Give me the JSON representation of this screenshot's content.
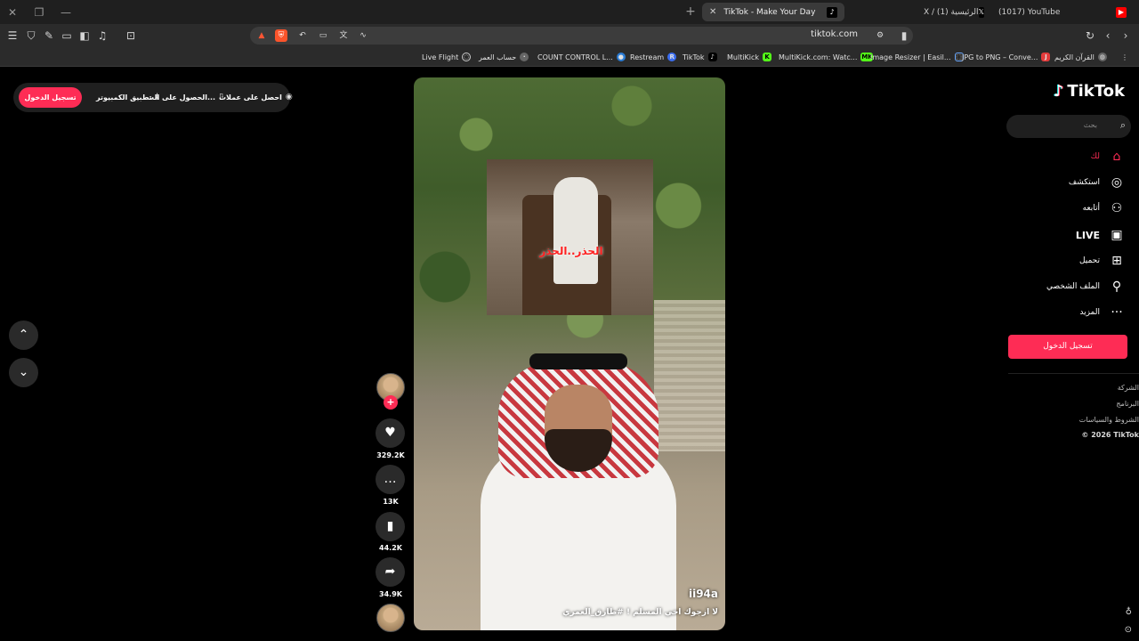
{
  "browser": {
    "tabs": [
      {
        "label": "TikTok - Make Your Day",
        "active": true
      },
      {
        "label": "X / الرئيسية (1)",
        "active": false
      },
      {
        "label": "(1017) YouTube",
        "active": false
      }
    ],
    "url": "tiktok.com",
    "window_buttons": {
      "close": "✕",
      "restore": "❐",
      "minimize": "—"
    }
  },
  "bookmarks": [
    {
      "label": "Live Flight",
      "icon": "globe-icon"
    },
    {
      "label": "حساب العمر",
      "icon": "calc-icon"
    },
    {
      "label": "COUNT CONTROL L...",
      "icon": "count-icon"
    },
    {
      "label": "Restream",
      "icon": "restream-icon"
    },
    {
      "label": "TikTok",
      "icon": "tiktok-icon"
    },
    {
      "label": "MultiKick",
      "icon": "multikick-icon"
    },
    {
      "label": "MultiKick.com: Watc...",
      "icon": "mk-icon"
    },
    {
      "label": "Image Resizer | Easil...",
      "icon": "resize-icon"
    },
    {
      "label": "JPG to PNG – Conve...",
      "icon": "jpg-icon"
    },
    {
      "label": "القرآن الكريم",
      "icon": "quran-icon"
    }
  ],
  "top_pill": {
    "login": "تسجيل الدخول",
    "desktop_app": "تطبيق الكمبيوتر",
    "get_app": "الحصول على الت...",
    "get_coins": "احصل على عملات"
  },
  "video": {
    "handle": "ii94a",
    "description": "لا ازجوك اخي المسلم ! #طارق_العمري",
    "inset_caption": "الحذر..الحذر"
  },
  "actions": {
    "likes": "329.2K",
    "comments": "13K",
    "saves": "44.2K",
    "shares": "34.9K"
  },
  "sidebar": {
    "logo": "TikTok",
    "search_placeholder": "بحث",
    "menu": [
      {
        "label": "لك",
        "icon": "home-icon",
        "active": true
      },
      {
        "label": "استكشف",
        "icon": "compass-icon"
      },
      {
        "label": "أتابعه",
        "icon": "following-icon"
      },
      {
        "label": "LIVE",
        "icon": "live-icon"
      },
      {
        "label": "تحميل",
        "icon": "upload-icon"
      },
      {
        "label": "الملف الشخصي",
        "icon": "profile-icon"
      },
      {
        "label": "المزيد",
        "icon": "more-icon"
      }
    ],
    "login": "تسجيل الدخول",
    "footer": [
      "الشركة",
      "البرنامج",
      "الشروط والسياسات",
      "© 2026 TikTok"
    ]
  },
  "colors": {
    "accent": "#fe2c55",
    "background": "#000000",
    "chrome": "#2b2b2b"
  }
}
